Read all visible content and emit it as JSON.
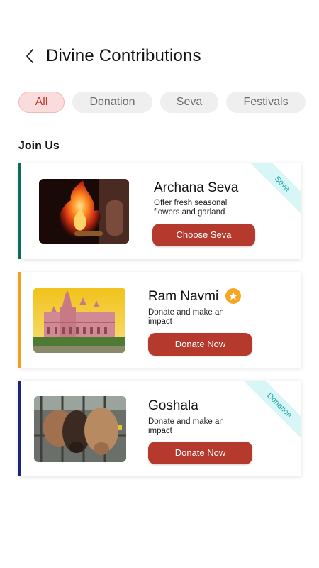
{
  "header": {
    "title": "Divine Contributions"
  },
  "tabs": [
    {
      "label": "All",
      "active": true
    },
    {
      "label": "Donation",
      "active": false
    },
    {
      "label": "Seva",
      "active": false
    },
    {
      "label": "Festivals",
      "active": false
    }
  ],
  "section": {
    "title": "Join Us"
  },
  "cards": [
    {
      "name": "Archana Seva",
      "description": "Offer fresh seasonal flowers and garland",
      "button": "Choose Seva",
      "ribbon": "Seva",
      "accent_color": "#0e6b5c",
      "image": "fire-aarti-image"
    },
    {
      "name": "Ram Navmi",
      "description": "Donate and make an impact",
      "button": "Donate Now",
      "badge_icon": "star-icon",
      "accent_color": "#f0a020",
      "image": "temple-image"
    },
    {
      "name": "Goshala",
      "description": "Donate and make an impact",
      "button": "Donate Now",
      "ribbon": "Donation",
      "accent_color": "#1a237e",
      "image": "cows-image"
    }
  ],
  "colors": {
    "primary_button": "#b5392d",
    "active_tab_bg": "#fadcdc",
    "active_tab_text": "#c0392b",
    "ribbon_bg": "#d9f6f6",
    "ribbon_text": "#1aa5a5"
  }
}
